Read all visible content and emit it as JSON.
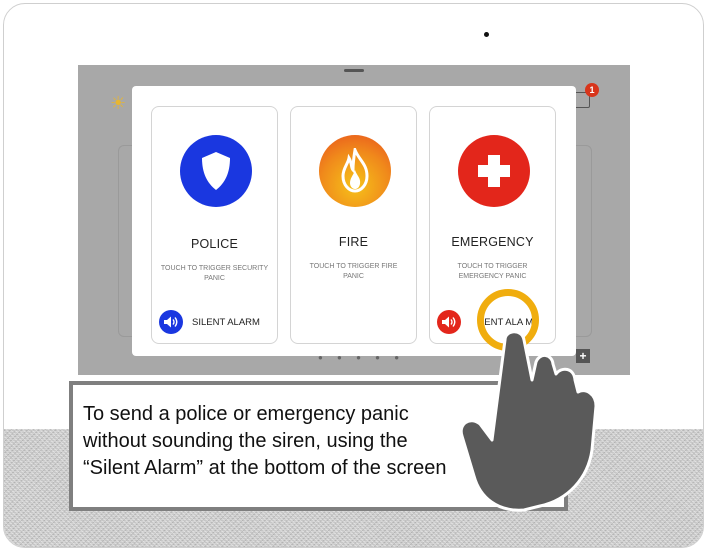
{
  "panel": {
    "cards": [
      {
        "title": "POLICE",
        "subtitle": "TOUCH TO TRIGGER SECURITY PANIC",
        "icon": "shield-icon",
        "color": "#1a37e0",
        "silent_label": "SILENT ALARM"
      },
      {
        "title": "FIRE",
        "subtitle": "TOUCH TO TRIGGER FIRE PANIC",
        "icon": "flame-icon",
        "color": "#f07a1c"
      },
      {
        "title": "EMERGENCY",
        "subtitle": "TOUCH TO TRIGGER EMERGENCY PANIC",
        "icon": "medical-cross-icon",
        "color": "#e3261b",
        "silent_label": "LENT ALA M"
      }
    ]
  },
  "background": {
    "notification_count": "1",
    "plus_label": "+"
  },
  "instruction": {
    "lines": [
      "To send a police or emergency panic",
      "without sounding the siren, using the",
      "“Silent Alarm” at the bottom of the screen"
    ]
  },
  "colors": {
    "highlight_ring": "#f0ad0e",
    "hand": "#5a5a5a",
    "device_fabric": "#d2d2d2"
  }
}
